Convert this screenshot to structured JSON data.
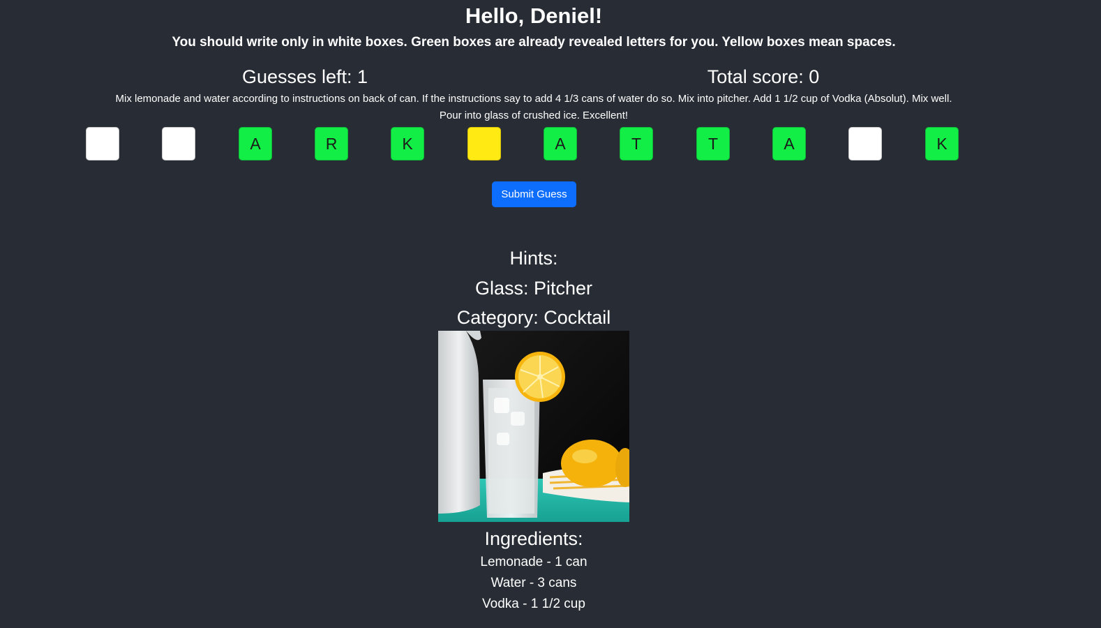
{
  "greeting": "Hello, Deniel!",
  "instructions": "You should write only in white boxes. Green boxes are already revealed letters for you. Yellow boxes mean spaces.",
  "stats": {
    "guesses_left": "Guesses left: 1",
    "total_score": "Total score: 0"
  },
  "recipe_instructions_line1": "Mix lemonade and water according to instructions on back of can. If the instructions say to add 4 1/3 cans of water do so. Mix into pitcher. Add 1 1/2 cup of Vodka (Absolut). Mix well.",
  "recipe_instructions_line2": "Pour into glass of crushed ice. Excellent!",
  "tiles": [
    {
      "type": "white",
      "letter": ""
    },
    {
      "type": "white",
      "letter": ""
    },
    {
      "type": "green",
      "letter": "A"
    },
    {
      "type": "green",
      "letter": "R"
    },
    {
      "type": "green",
      "letter": "K"
    },
    {
      "type": "yellow",
      "letter": ""
    },
    {
      "type": "green",
      "letter": "A"
    },
    {
      "type": "green",
      "letter": "T"
    },
    {
      "type": "green",
      "letter": "T"
    },
    {
      "type": "green",
      "letter": "A"
    },
    {
      "type": "white",
      "letter": ""
    },
    {
      "type": "green",
      "letter": "K"
    }
  ],
  "submit_label": "Submit Guess",
  "hints": {
    "title": "Hints:",
    "glass": "Glass: Pitcher",
    "category": "Category: Cocktail"
  },
  "ingredients": {
    "title": "Ingredients:",
    "items": [
      "Lemonade - 1 can",
      "Water - 3 cans",
      "Vodka - 1 1/2 cup"
    ]
  },
  "colors": {
    "background": "#282c34",
    "tile_green": "#12ee46",
    "tile_yellow": "#ffea14",
    "tile_white": "#ffffff",
    "button": "#0d6efd"
  }
}
